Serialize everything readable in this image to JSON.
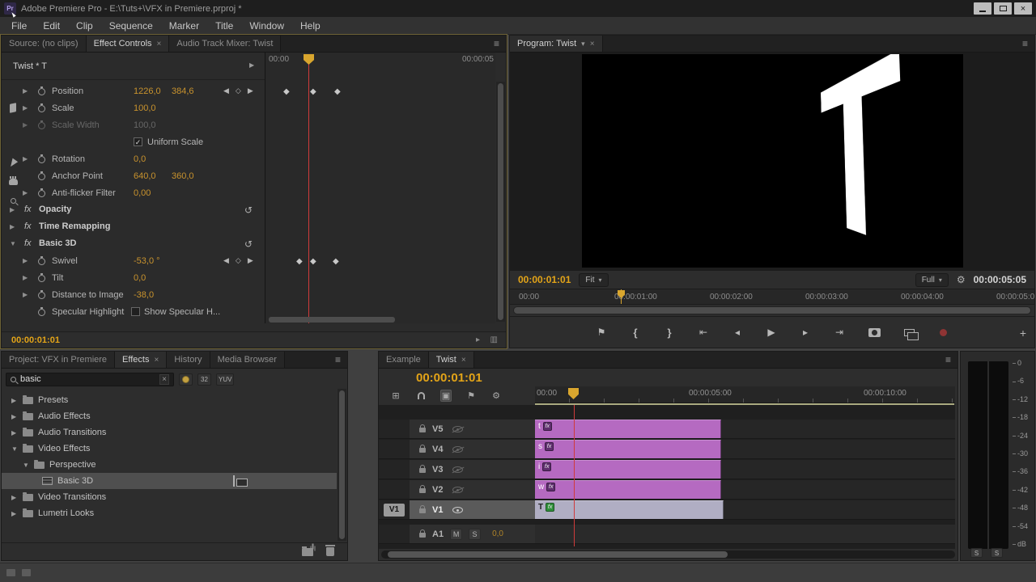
{
  "window": {
    "logo": "Pr",
    "title": "Adobe Premiere Pro - E:\\Tuts+\\VFX in Premiere.prproj *",
    "close": "×"
  },
  "menu": {
    "items": [
      "File",
      "Edit",
      "Clip",
      "Sequence",
      "Marker",
      "Title",
      "Window",
      "Help"
    ]
  },
  "icons": {
    "panel_menu": "≡",
    "close": "×",
    "tw_open": "▼",
    "tw_closed": "▶",
    "kf_prev": "◀",
    "kf_add": "◇",
    "kf_next": "▶",
    "kf": "◆",
    "reset": "↺",
    "check": "✓",
    "dropdown": "▾",
    "plus": "+",
    "fx": "fx",
    "play": "▸",
    "grid": "▥",
    "flag": "⚑",
    "brace_open": "{",
    "brace_close": "}",
    "goto_in": "⇤",
    "goto_out": "⇥",
    "step_back": "◂",
    "step_fwd": "▸",
    "play_big": "▶",
    "wrench": "⚙",
    "tl_insert": "⊞",
    "tl_link": "▣",
    "tool_select": "▲",
    "tool_track": "⇉",
    "tool_ripple": "⇹",
    "tool_rolling": "⇅",
    "tool_rate": "⇻",
    "tool_slip": "⇆",
    "tool_slide": "⇄"
  },
  "colors": {
    "value_orange": "#c9932d",
    "timecode": "#e3a418",
    "playhead_red": "#d03b3b",
    "playhead_gold": "#d9a62e",
    "clip_purple": "#b56ac1",
    "clip_gray": "#b0aec3",
    "fx_badge_purple": "#5f2f6e",
    "fx_badge_green": "#2f8f3a"
  },
  "effect_controls": {
    "tabs": [
      "Source: (no clips)",
      "Effect Controls",
      "Audio Track Mixer: Twist"
    ],
    "clip_title": "Twist * T",
    "ruler": [
      "00:00",
      "00:00:05"
    ],
    "rows": [
      {
        "name": "Position",
        "v1": "1226,0",
        "v2": "384,6"
      },
      {
        "name": "Scale",
        "v1": "100,0"
      },
      {
        "name": "Scale Width",
        "v1": "100,0"
      },
      {
        "name": "Uniform Scale"
      },
      {
        "name": "Rotation",
        "v1": "0,0"
      },
      {
        "name": "Anchor Point",
        "v1": "640,0",
        "v2": "360,0"
      },
      {
        "name": "Anti-flicker Filter",
        "v1": "0,00"
      },
      {
        "name": "Opacity"
      },
      {
        "name": "Time Remapping"
      },
      {
        "name": "Basic 3D"
      },
      {
        "name": "Swivel",
        "v1": "-53,0 °"
      },
      {
        "name": "Tilt",
        "v1": "0,0"
      },
      {
        "name": "Distance to Image",
        "v1": "-38,0"
      },
      {
        "name": "Specular Highlight",
        "label": "Show Specular H..."
      }
    ],
    "timecode": "00:00:01:01"
  },
  "program": {
    "tab": "Program: Twist",
    "letter": "T",
    "timecode": "00:00:01:01",
    "zoom": "Fit",
    "resolution": "Full",
    "duration": "00:00:05:05",
    "ruler": [
      "00:00",
      "00:00:01:00",
      "00:00:02:00",
      "00:00:03:00",
      "00:00:04:00",
      "00:00:05:0"
    ]
  },
  "project": {
    "tabs": [
      "Project: VFX in Premiere",
      "Effects",
      "History",
      "Media Browser"
    ],
    "search": {
      "value": "basic"
    },
    "badges": {
      "b32": "32",
      "yuv": "YUV"
    },
    "tree": [
      {
        "label": "Presets"
      },
      {
        "label": "Audio Effects"
      },
      {
        "label": "Audio Transitions"
      },
      {
        "label": "Video Effects"
      },
      {
        "label": "Perspective"
      },
      {
        "label": "Basic 3D"
      },
      {
        "label": "Video Transitions"
      },
      {
        "label": "Lumetri Looks"
      }
    ]
  },
  "timeline": {
    "tabs": [
      "Example",
      "Twist"
    ],
    "timecode": "00:00:01:01",
    "ruler": [
      "00:00",
      "00:00:05:00",
      "00:00:10:00"
    ],
    "tracks": [
      {
        "name": "V5",
        "clip": "t"
      },
      {
        "name": "V4",
        "clip": "s"
      },
      {
        "name": "V3",
        "clip": "i"
      },
      {
        "name": "V2",
        "clip": "w"
      },
      {
        "name": "V1",
        "clip": "T",
        "patch": "V1"
      }
    ],
    "audio": {
      "name": "A1",
      "mute": "M",
      "solo": "S",
      "volume": "0,0"
    }
  },
  "meters": {
    "scale": [
      "0",
      "-6",
      "-12",
      "-18",
      "-24",
      "-30",
      "-36",
      "-42",
      "-48",
      "-54",
      "dB"
    ],
    "solo": "S"
  }
}
